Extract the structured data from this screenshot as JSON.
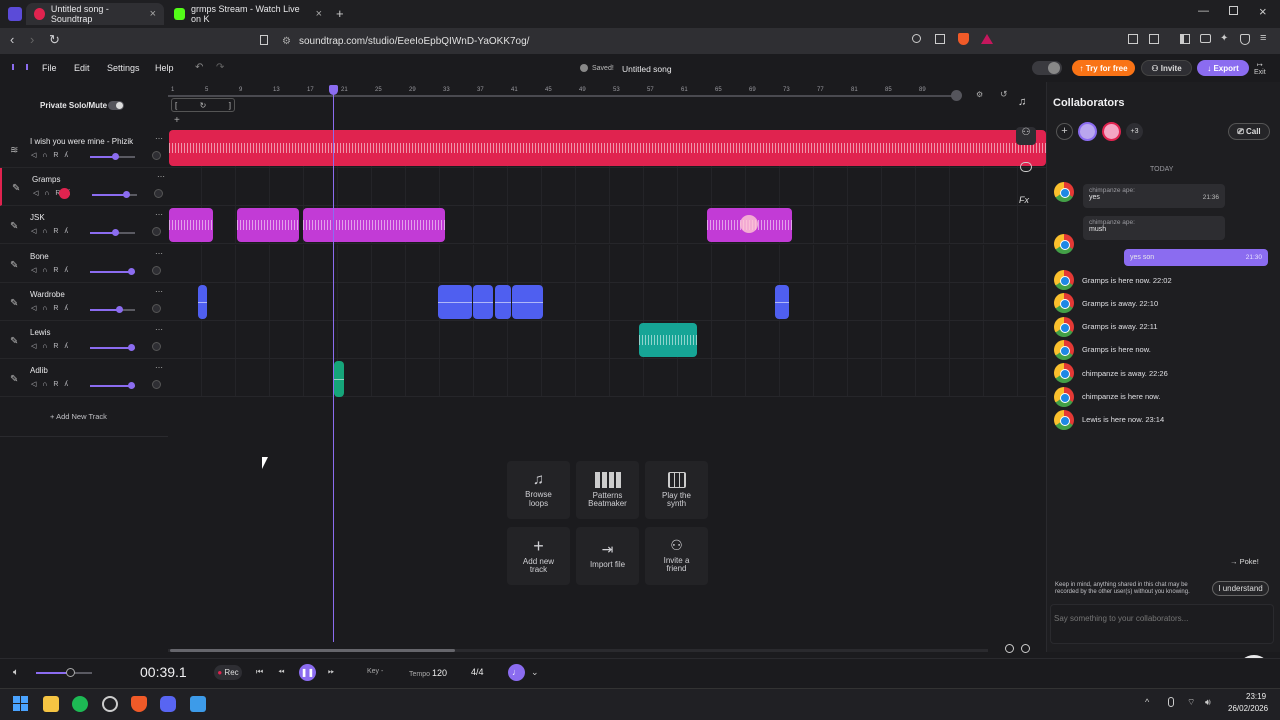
{
  "browser": {
    "tabs": [
      {
        "title": "Untitled song - Soundtrap",
        "active": true
      },
      {
        "title": "grmps Stream - Watch Live on K",
        "active": false
      }
    ],
    "url": "soundtrap.com/studio/EeeIoEpbQIWnD-YaOKK7og/"
  },
  "app": {
    "menu": [
      "File",
      "Edit",
      "Settings",
      "Help"
    ],
    "saved_label": "Saved!",
    "song_title": "Untitled song",
    "try_label": "Try for free",
    "invite_label": "Invite",
    "export_label": "Export",
    "exit_label": "Exit"
  },
  "ruler": {
    "marks": [
      "1",
      "5",
      "9",
      "13",
      "17",
      "21",
      "25",
      "29",
      "33",
      "37",
      "41",
      "45",
      "49",
      "53",
      "57",
      "61",
      "65",
      "69",
      "73",
      "77",
      "81",
      "85",
      "89"
    ]
  },
  "tracks_panel": {
    "solo_label": "Private Solo/Mute",
    "add_track_label": "Add New Track",
    "tracks": [
      {
        "name": "I wish you were mine - Phizik",
        "volume": 0.55
      },
      {
        "name": "Gramps",
        "volume": 0.75
      },
      {
        "name": "JSK",
        "volume": 0.55
      },
      {
        "name": "Bone",
        "volume": 0.9
      },
      {
        "name": "Wardrobe",
        "volume": 0.65
      },
      {
        "name": "Lewis",
        "volume": 0.92
      },
      {
        "name": "Adlib",
        "volume": 0.92
      }
    ]
  },
  "actions": [
    {
      "label": "Browse loops",
      "icon": "music-note-icon"
    },
    {
      "label": "Patterns Beatmaker",
      "icon": "grid-icon"
    },
    {
      "label": "Play the synth",
      "icon": "piano-icon"
    },
    {
      "label": "Add new track",
      "icon": "plus-icon"
    },
    {
      "label": "Import file",
      "icon": "import-icon"
    },
    {
      "label": "Invite a friend",
      "icon": "invite-icon"
    }
  ],
  "collab": {
    "title": "Collaborators",
    "more_count": "+3",
    "call_label": "Call",
    "day_label": "TODAY",
    "chat": [
      {
        "author": "chimpanze ape:",
        "text": "yes",
        "time": "21:36"
      },
      {
        "author": "chimpanze ape:",
        "text": "mush",
        "time": ""
      }
    ],
    "own_message": {
      "text": "yes son",
      "time": "21:30"
    },
    "events": [
      "Gramps is here now. 22:02",
      "Gramps is away. 22:10",
      "Gramps is away. 22:11",
      "Gramps is here now.",
      "chimpanze is away. 22:26",
      "chimpanze is here now.",
      "Lewis is here now. 23:14"
    ],
    "poke_label": "Poke!",
    "notice": "Keep in mind, anything shared in this chat may be recorded by the other user(s) without you knowing.",
    "understand_label": "I understand",
    "input_placeholder": "Say something to your collaborators..."
  },
  "transport": {
    "time": "00:39.1",
    "rec_label": "Rec",
    "key_label": "Key",
    "key_value": "-",
    "tempo_label": "Tempo",
    "tempo_value": "120",
    "meter": "4/4",
    "master_volume": 0.6
  },
  "taskbar": {
    "time": "23:19",
    "date": "26/02/2026"
  },
  "colors": {
    "accent": "#8b6cf0",
    "track1": "#e0234f",
    "jsk": "#c23bd6",
    "wardrobe": "#4f5ff0",
    "lewis": "#16a596",
    "adlib": "#16a57a"
  }
}
